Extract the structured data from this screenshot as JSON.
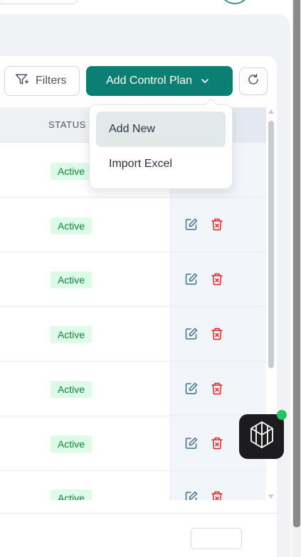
{
  "toolbar": {
    "filters_label": "Filters",
    "add_label": "Add Control Plan",
    "filter_icon": "filter-icon",
    "chevron_icon": "chevron-down-icon",
    "refresh_icon": "refresh-icon"
  },
  "dropdown": {
    "items": [
      {
        "label": "Add New",
        "active": true
      },
      {
        "label": "Import Excel",
        "active": false
      }
    ]
  },
  "table": {
    "status_header": "STATUS",
    "rows": [
      {
        "status": "Active"
      },
      {
        "status": "Active"
      },
      {
        "status": "Active"
      },
      {
        "status": "Active"
      },
      {
        "status": "Active"
      },
      {
        "status": "Active"
      },
      {
        "status": "Active"
      }
    ]
  },
  "colors": {
    "accent": "#0a7f72",
    "status_active_bg": "#dcfce7",
    "status_active_text": "#15803d",
    "edit_icon": "#3f6f8f",
    "delete_icon": "#dc2626",
    "widget_online": "#22c55e"
  }
}
